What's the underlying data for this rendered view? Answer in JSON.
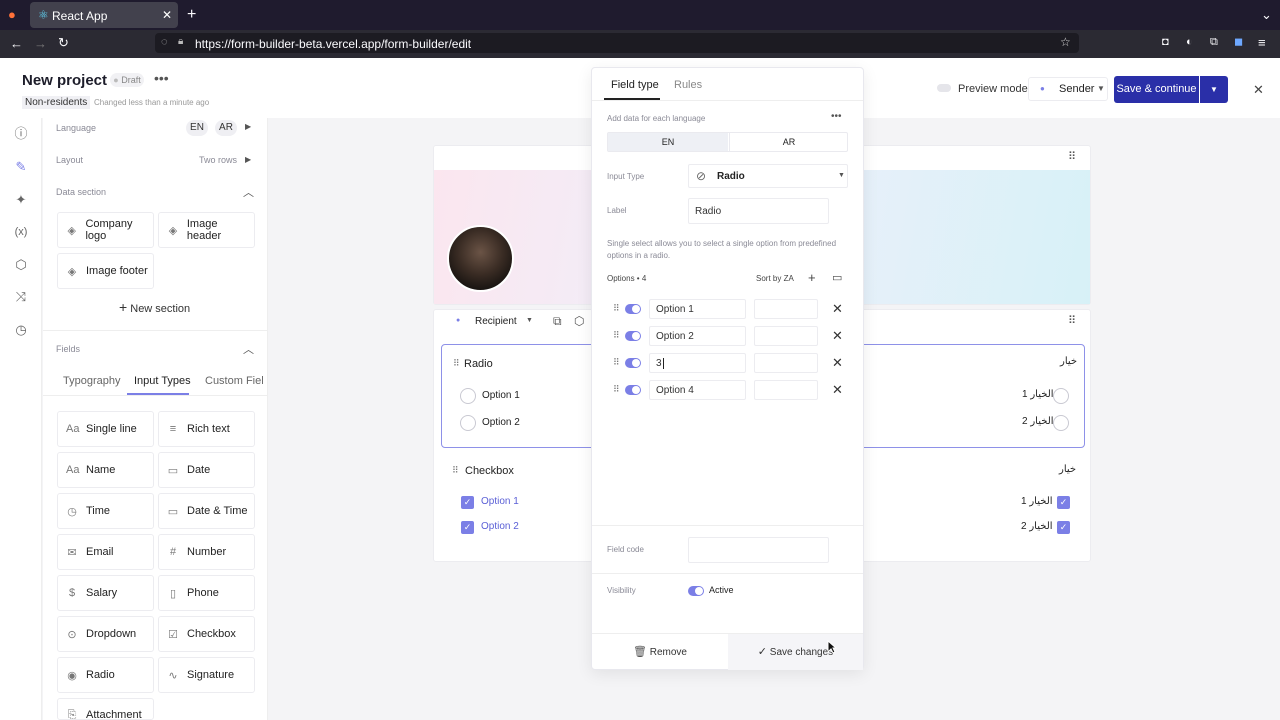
{
  "browser": {
    "tab_title": "React App",
    "url": "https://form-builder-beta.vercel.app/form-builder/edit"
  },
  "header": {
    "project_title": "New project",
    "status_badge": "Draft",
    "subtitle_tag": "Non-residents",
    "changed_text": "Changed less than a minute ago",
    "preview_label": "Preview mode",
    "sender_label": "Sender",
    "save_continue": "Save & continue"
  },
  "left_panel": {
    "language_label": "Language",
    "lang_en": "EN",
    "lang_ar": "AR",
    "layout_label": "Layout",
    "layout_value": "Two rows",
    "data_section_label": "Data section",
    "data_items": [
      "Company logo",
      "Image header",
      "Image footer"
    ],
    "new_section": "New section",
    "fields_label": "Fields",
    "tabs": [
      "Typography",
      "Input Types",
      "Custom Fiel"
    ],
    "field_types": [
      "Single line",
      "Rich text",
      "Name",
      "Date",
      "Time",
      "Date & Time",
      "Email",
      "Number",
      "Salary",
      "Phone",
      "Dropdown",
      "Checkbox",
      "Radio",
      "Signature",
      "Attachment"
    ]
  },
  "canvas": {
    "recipient_label": "Recipient",
    "radio_title": "Radio",
    "radio_title_ar": "خيار",
    "radio_options": [
      "Option 1",
      "Option 2"
    ],
    "radio_options_ar": [
      "الخيار 1",
      "الخيار 2"
    ],
    "checkbox_title": "Checkbox",
    "checkbox_title_ar": "خيار",
    "checkbox_options": [
      "Option 1",
      "Option 2"
    ],
    "checkbox_options_ar": [
      "الخيار 1",
      "الخيار 2"
    ]
  },
  "popover": {
    "tab_field_type": "Field type",
    "tab_rules": "Rules",
    "add_data_hint": "Add data for each language",
    "lang_tabs": [
      "EN",
      "AR"
    ],
    "input_type_label": "Input Type",
    "input_type_value": "Radio",
    "label_label": "Label",
    "label_value": "Radio",
    "description": "Single select allows you to select a single option from predefined options in a radio.",
    "options_label": "Options",
    "options_count": "4",
    "sort_label": "Sort by ZA",
    "options": [
      "Option 1",
      "Option 2",
      "3",
      "Option 4"
    ],
    "field_code_label": "Field code",
    "visibility_label": "Visibility",
    "visibility_value": "Active",
    "remove_label": "Remove",
    "save_label": "Save changes"
  },
  "colors": {
    "accent": "#7b7fe6",
    "primary_button": "#2a2fa8",
    "browser_dark": "#1f1b2e"
  }
}
